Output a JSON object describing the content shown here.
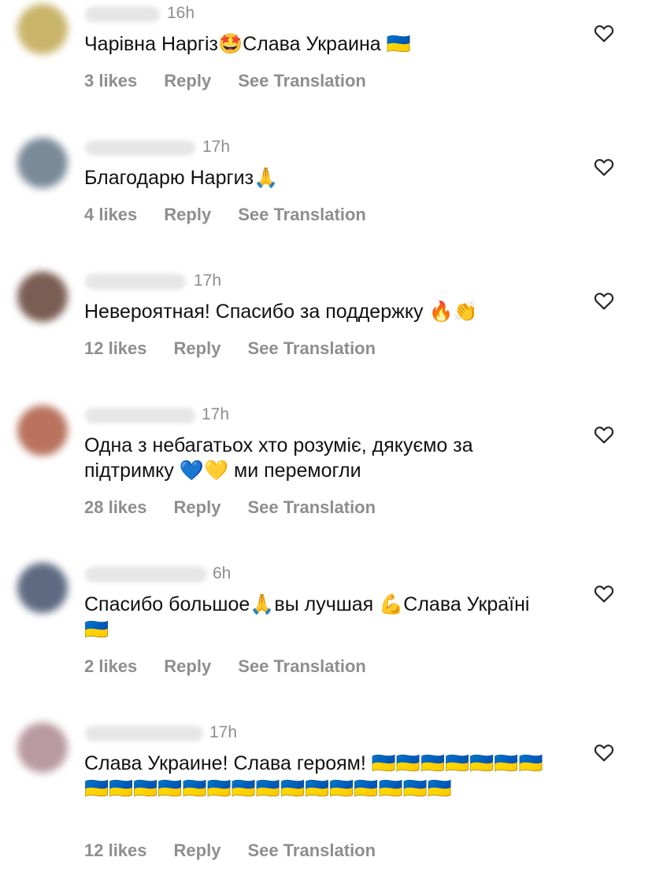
{
  "comments": [
    {
      "time": "16h",
      "text": "Чарівна Наргіз🤩Слава Украина 🇺🇦",
      "likes": "3 likes",
      "reply": "Reply",
      "translate": "See Translation",
      "avatar_color": "#c9b46a"
    },
    {
      "time": "17h",
      "text": "Благодарю Наргиз🙏",
      "likes": "4 likes",
      "reply": "Reply",
      "translate": "See Translation",
      "avatar_color": "#7a8a99"
    },
    {
      "time": "17h",
      "text": "Невероятная! Спасибо за поддержку 🔥👏",
      "likes": "12 likes",
      "reply": "Reply",
      "translate": "See Translation",
      "avatar_color": "#7a5e54"
    },
    {
      "time": "17h",
      "text": "Одна з небагатьох хто розуміє, дякуємо за підтримку 💙💛 ми перемогли",
      "likes": "28 likes",
      "reply": "Reply",
      "translate": "See Translation",
      "avatar_color": "#b9735e"
    },
    {
      "time": "6h",
      "text": "Спасибо большое🙏вы лучшая 💪Слава Україні 🇺🇦",
      "likes": "2 likes",
      "reply": "Reply",
      "translate": "See Translation",
      "avatar_color": "#5d6a82"
    },
    {
      "time": "17h",
      "text": "Слава Украине! Слава героям! 🇺🇦🇺🇦🇺🇦🇺🇦🇺🇦🇺🇦🇺🇦🇺🇦🇺🇦🇺🇦🇺🇦🇺🇦🇺🇦🇺🇦🇺🇦🇺🇦🇺🇦🇺🇦🇺🇦🇺🇦🇺🇦🇺🇦",
      "likes": "12 likes",
      "reply": "Reply",
      "translate": "See Translation",
      "avatar_color": "#b99aa3"
    }
  ],
  "icons": {
    "like": "heart-outline-icon"
  }
}
